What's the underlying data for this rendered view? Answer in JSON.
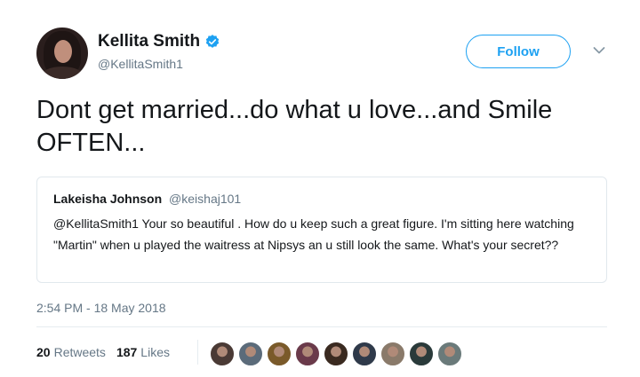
{
  "author": {
    "display_name": "Kellita Smith",
    "handle": "@KellitaSmith1",
    "verified": true
  },
  "follow_label": "Follow",
  "tweet_text": "Dont get married...do what u love...and Smile OFTEN...",
  "quoted_tweet": {
    "name": "Lakeisha Johnson",
    "handle": "@keishaj101",
    "text": "@KellitaSmith1 Your so beautiful . How do u keep such a great figure. I'm sitting here watching \"Martin\" when u played the waitress at Nipsys an u still look the same. What's your secret??"
  },
  "timestamp": "2:54 PM - 18 May 2018",
  "stats": {
    "retweets_count": "20",
    "retweets_label": "Retweets",
    "likes_count": "187",
    "likes_label": "Likes"
  },
  "colors": {
    "accent": "#1da1f2",
    "secondary_text": "#657786"
  },
  "liker_avatars": [
    "#4a3a35",
    "#5b6b7a",
    "#7a5a2a",
    "#6a3a4a",
    "#3a2a20",
    "#2f3a4a",
    "#8a7a6a",
    "#2a3a3a",
    "#6a7a7a"
  ]
}
